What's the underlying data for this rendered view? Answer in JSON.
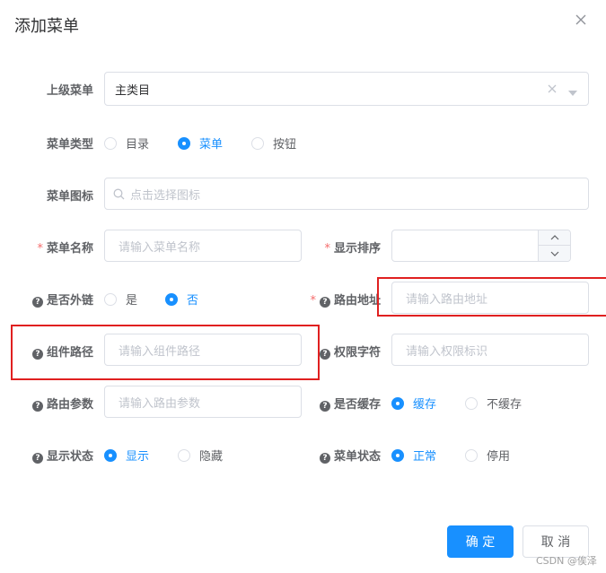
{
  "dialog": {
    "title": "添加菜单",
    "watermark": "CSDN @俟泽"
  },
  "form": {
    "parent_menu": {
      "label": "上级菜单",
      "value": "主类目"
    },
    "menu_type": {
      "label": "菜单类型",
      "options": [
        "目录",
        "菜单",
        "按钮"
      ],
      "selected": "菜单"
    },
    "menu_icon": {
      "label": "菜单图标",
      "placeholder": "点击选择图标"
    },
    "menu_name": {
      "label": "菜单名称",
      "required_mark": "*",
      "placeholder": "请输入菜单名称"
    },
    "display_order": {
      "label": "显示排序",
      "required_mark": "*"
    },
    "is_external": {
      "label": "是否外链",
      "options": [
        "是",
        "否"
      ],
      "selected": "否"
    },
    "route_path": {
      "label": "路由地址",
      "required_mark": "*",
      "placeholder": "请输入路由地址"
    },
    "component_path": {
      "label": "组件路径",
      "placeholder": "请输入组件路径"
    },
    "permission": {
      "label": "权限字符",
      "placeholder": "请输入权限标识"
    },
    "route_params": {
      "label": "路由参数",
      "placeholder": "请输入路由参数"
    },
    "is_cache": {
      "label": "是否缓存",
      "options": [
        "缓存",
        "不缓存"
      ],
      "selected": "缓存"
    },
    "visible": {
      "label": "显示状态",
      "options": [
        "显示",
        "隐藏"
      ],
      "selected": "显示"
    },
    "status": {
      "label": "菜单状态",
      "options": [
        "正常",
        "停用"
      ],
      "selected": "正常"
    }
  },
  "footer": {
    "confirm_label": "确 定",
    "cancel_label": "取 消"
  },
  "colors": {
    "primary": "#1890ff",
    "annotation_red": "#e02020",
    "required": "#f56c6c"
  },
  "icons": [
    "close-icon",
    "clear-icon",
    "caret-down-icon",
    "search-icon",
    "question-icon",
    "chevron-up-icon",
    "chevron-down-icon"
  ]
}
